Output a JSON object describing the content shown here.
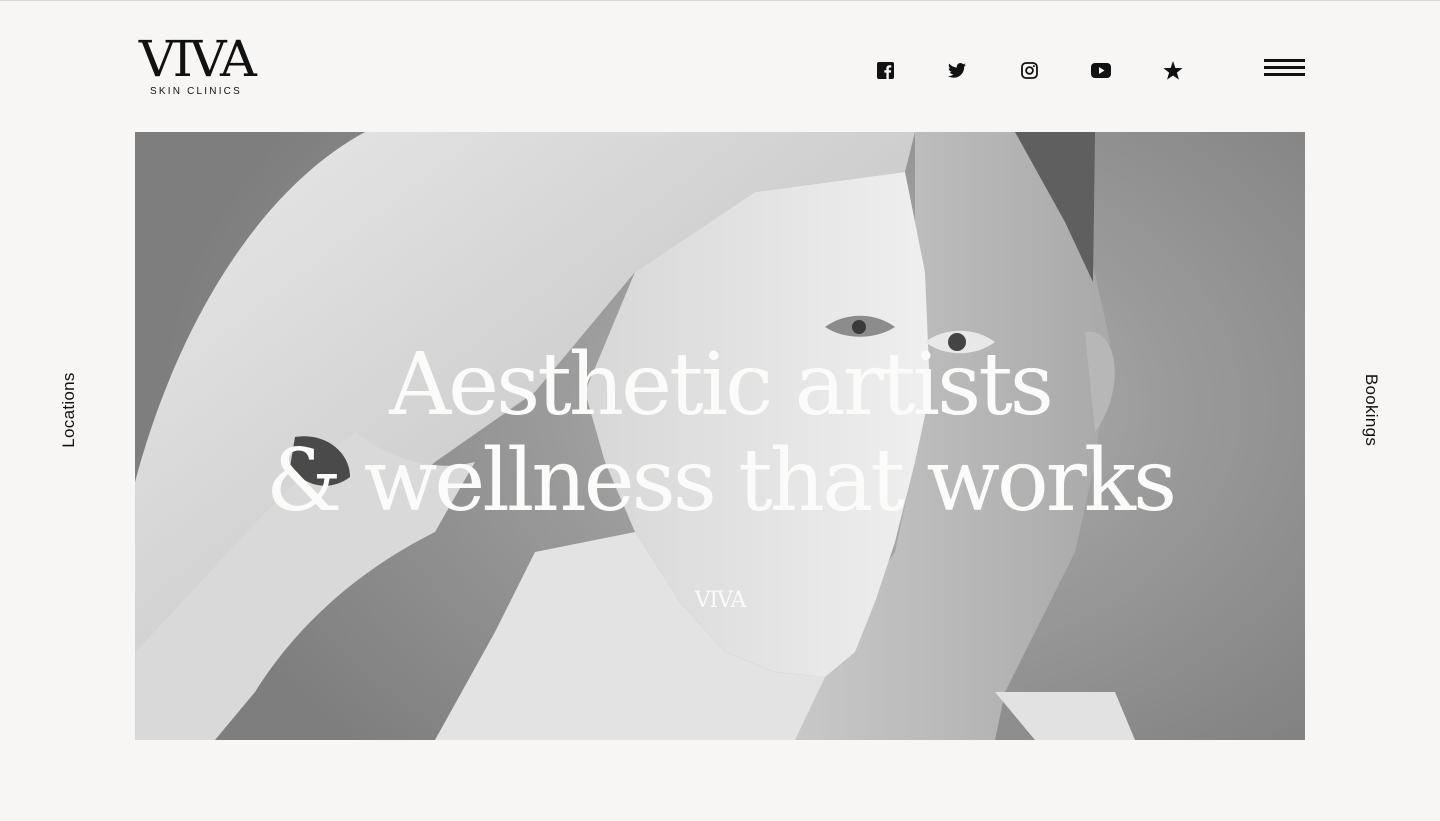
{
  "brand": {
    "name": "VIVA",
    "tagline": "SKIN CLINICS"
  },
  "header": {
    "social": [
      {
        "icon": "facebook-icon"
      },
      {
        "icon": "twitter-icon"
      },
      {
        "icon": "instagram-icon"
      },
      {
        "icon": "youtube-icon"
      },
      {
        "icon": "star-icon"
      }
    ],
    "menu_icon": "hamburger-menu-icon"
  },
  "side_nav": {
    "left_label": "Locations",
    "right_label": "Bookings"
  },
  "hero": {
    "headline_line1": "Aesthetic artists",
    "headline_line2": "& wellness that works",
    "mark": "VIVA",
    "image": "black-and-white-portrait-woman-and-man-faces"
  },
  "colors": {
    "background": "#f7f6f4",
    "text": "#111111",
    "hero_text": "#fbfbfa"
  }
}
